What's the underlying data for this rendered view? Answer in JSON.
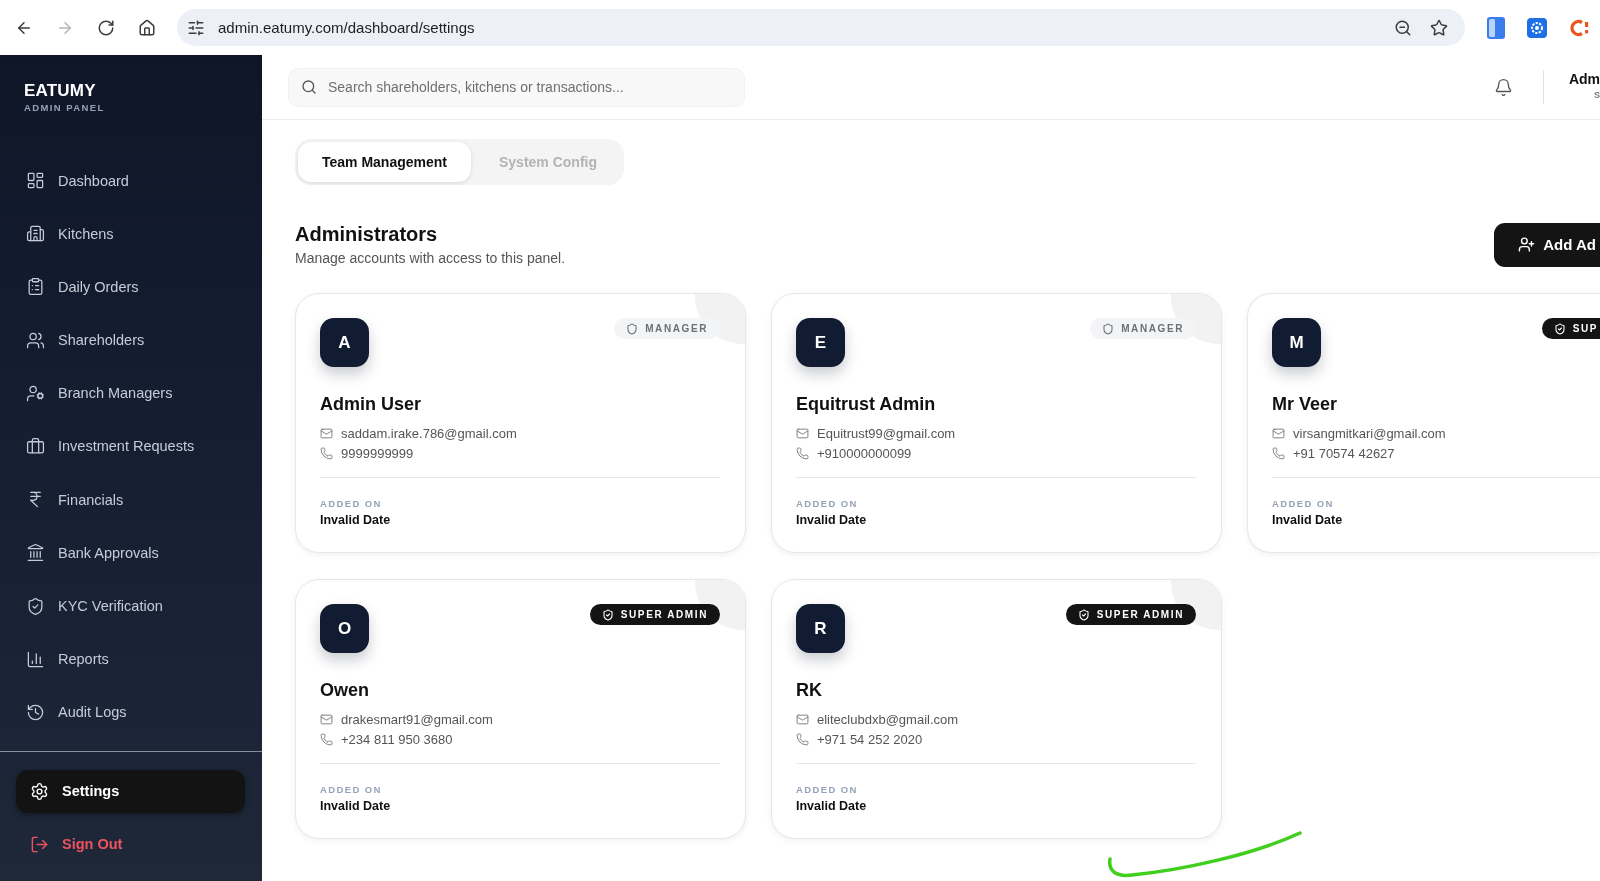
{
  "browser": {
    "url": "admin.eatumy.com/dashboard/settings",
    "forward_disabled": true
  },
  "sidebar": {
    "brand": "EATUMY",
    "subtitle": "ADMIN PANEL",
    "items": [
      {
        "label": "Dashboard",
        "selected": false
      },
      {
        "label": "Kitchens",
        "selected": false
      },
      {
        "label": "Daily Orders",
        "selected": false
      },
      {
        "label": "Shareholders",
        "selected": false
      },
      {
        "label": "Branch Managers",
        "selected": false
      },
      {
        "label": "Investment Requests",
        "selected": false
      },
      {
        "label": "Financials",
        "selected": false
      },
      {
        "label": "Bank Approvals",
        "selected": false
      },
      {
        "label": "KYC Verification",
        "selected": false
      },
      {
        "label": "Reports",
        "selected": false
      },
      {
        "label": "Audit Logs",
        "selected": false
      }
    ],
    "settings": {
      "label": "Settings",
      "selected": true
    },
    "sign_out": {
      "label": "Sign Out"
    }
  },
  "header": {
    "search": {
      "placeholder": "Search shareholders, kitchens or transactions..."
    },
    "user": {
      "name": "Adm",
      "role": "S"
    }
  },
  "tabs": [
    {
      "label": "Team Management",
      "selected": true
    },
    {
      "label": "System Config",
      "selected": false
    }
  ],
  "section": {
    "title": "Administrators",
    "subtitle": "Manage accounts with access to this panel.",
    "add_button": "Add Ad"
  },
  "admins": [
    {
      "initial": "A",
      "name": "Admin User",
      "email": "saddam.irake.786@gmail.com",
      "phone": "9999999999",
      "role": {
        "kind": "manager",
        "label": "MANAGER"
      },
      "added_label": "ADDED ON",
      "added_on": "Invalid Date"
    },
    {
      "initial": "E",
      "name": "Equitrust Admin",
      "email": "Equitrust99@gmail.com",
      "phone": "+910000000099",
      "role": {
        "kind": "manager",
        "label": "MANAGER"
      },
      "added_label": "ADDED ON",
      "added_on": "Invalid Date"
    },
    {
      "initial": "M",
      "name": "Mr Veer",
      "email": "virsangmitkari@gmail.com",
      "phone": "+91 70574 42627",
      "role": {
        "kind": "super_admin",
        "label": "SUP"
      },
      "added_label": "ADDED ON",
      "added_on": "Invalid Date"
    },
    {
      "initial": "O",
      "name": "Owen",
      "email": "drakesmart91@gmail.com",
      "phone": "+234 811 950 3680",
      "role": {
        "kind": "super_admin",
        "label": "SUPER ADMIN"
      },
      "added_label": "ADDED ON",
      "added_on": "Invalid Date"
    },
    {
      "initial": "R",
      "name": "RK",
      "email": "eliteclubdxb@gmail.com",
      "phone": "+971 54 252 2020",
      "role": {
        "kind": "super_admin",
        "label": "SUPER ADMIN"
      },
      "added_label": "ADDED ON",
      "added_on": "Invalid Date"
    }
  ]
}
